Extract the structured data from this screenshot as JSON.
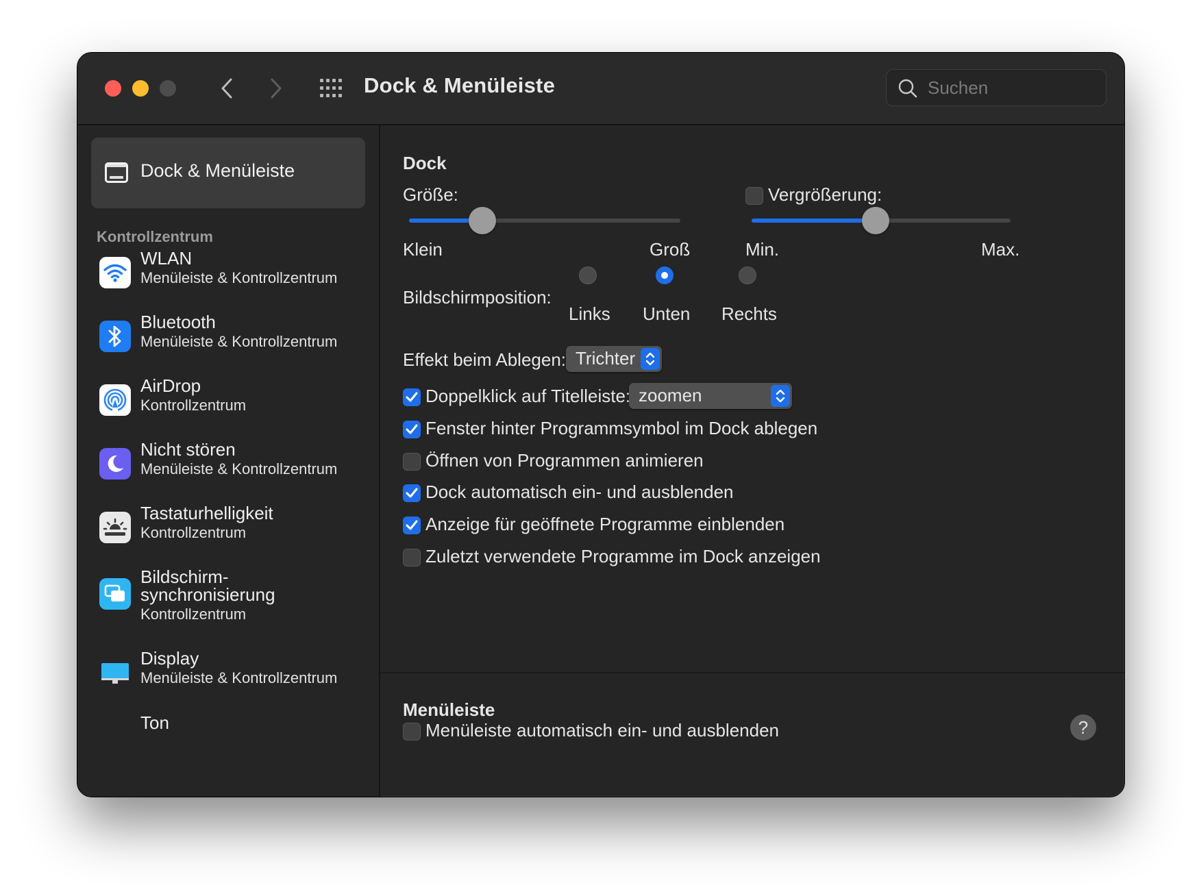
{
  "window": {
    "title": "Dock & Menüleiste",
    "search_placeholder": "Suchen"
  },
  "sidebar": {
    "selected_label": "Dock & Menüleiste",
    "section_label": "Kontrollzentrum",
    "items": [
      {
        "name": "WLAN",
        "sub": "Menüleiste & Kontrollzentrum",
        "icon": "wifi-icon",
        "color": "#ffffff"
      },
      {
        "name": "Bluetooth",
        "sub": "Menüleiste & Kontrollzentrum",
        "icon": "bluetooth-icon",
        "color": "#1f7cf3"
      },
      {
        "name": "AirDrop",
        "sub": "Kontrollzentrum",
        "icon": "airdrop-icon",
        "color": "#ffffff"
      },
      {
        "name": "Nicht stören",
        "sub": "Menüleiste & Kontrollzentrum",
        "icon": "moon-icon",
        "color": "#6a5ff0"
      },
      {
        "name": "Tastaturhelligkeit",
        "sub": "Kontrollzentrum",
        "icon": "keyboard-brightness-icon",
        "color": "#e9e9e9"
      },
      {
        "name_line1": "Bildschirm-",
        "name_line2": "synchronisierung",
        "sub": "Kontrollzentrum",
        "icon": "screen-mirroring-icon",
        "color": "#2fb6f2"
      },
      {
        "name": "Display",
        "sub": "Menüleiste & Kontrollzentrum",
        "icon": "display-icon",
        "color": "#2fb6f2"
      },
      {
        "name": "Ton",
        "partial": true
      }
    ]
  },
  "dock": {
    "heading": "Dock",
    "size_label": "Größe:",
    "size_min_label": "Klein",
    "size_max_label": "Groß",
    "size_value": 0.27,
    "magnification_label": "Vergrößerung:",
    "magnification_checked": false,
    "mag_min_label": "Min.",
    "mag_max_label": "Max.",
    "magnification_value": 0.48,
    "position_label": "Bildschirmposition:",
    "positions": [
      "Links",
      "Unten",
      "Rechts"
    ],
    "position_selected": "Unten",
    "minimize_effect_label": "Effekt beim Ablegen:",
    "minimize_effect_value": "Trichter",
    "doubleclick_label": "Doppelklick auf Titelleiste:",
    "doubleclick_checked": true,
    "doubleclick_value": "zoomen",
    "options": [
      {
        "label": "Fenster hinter Programmsymbol im Dock ablegen",
        "checked": true
      },
      {
        "label": "Öffnen von Programmen animieren",
        "checked": false
      },
      {
        "label": "Dock automatisch ein- und ausblenden",
        "checked": true
      },
      {
        "label": "Anzeige für geöffnete Programme einblenden",
        "checked": true
      },
      {
        "label": "Zuletzt verwendete Programme im Dock anzeigen",
        "checked": false
      }
    ]
  },
  "menubar": {
    "heading": "Menüleiste",
    "autohide_label": "Menüleiste automatisch ein- und ausblenden",
    "autohide_checked": false
  },
  "help_label": "?",
  "colors": {
    "accent": "#1f6ee8",
    "window_bg": "#252525",
    "close": "#ff5f57",
    "minimize": "#febc2e",
    "zoom_inactive": "#4d4d4d"
  }
}
